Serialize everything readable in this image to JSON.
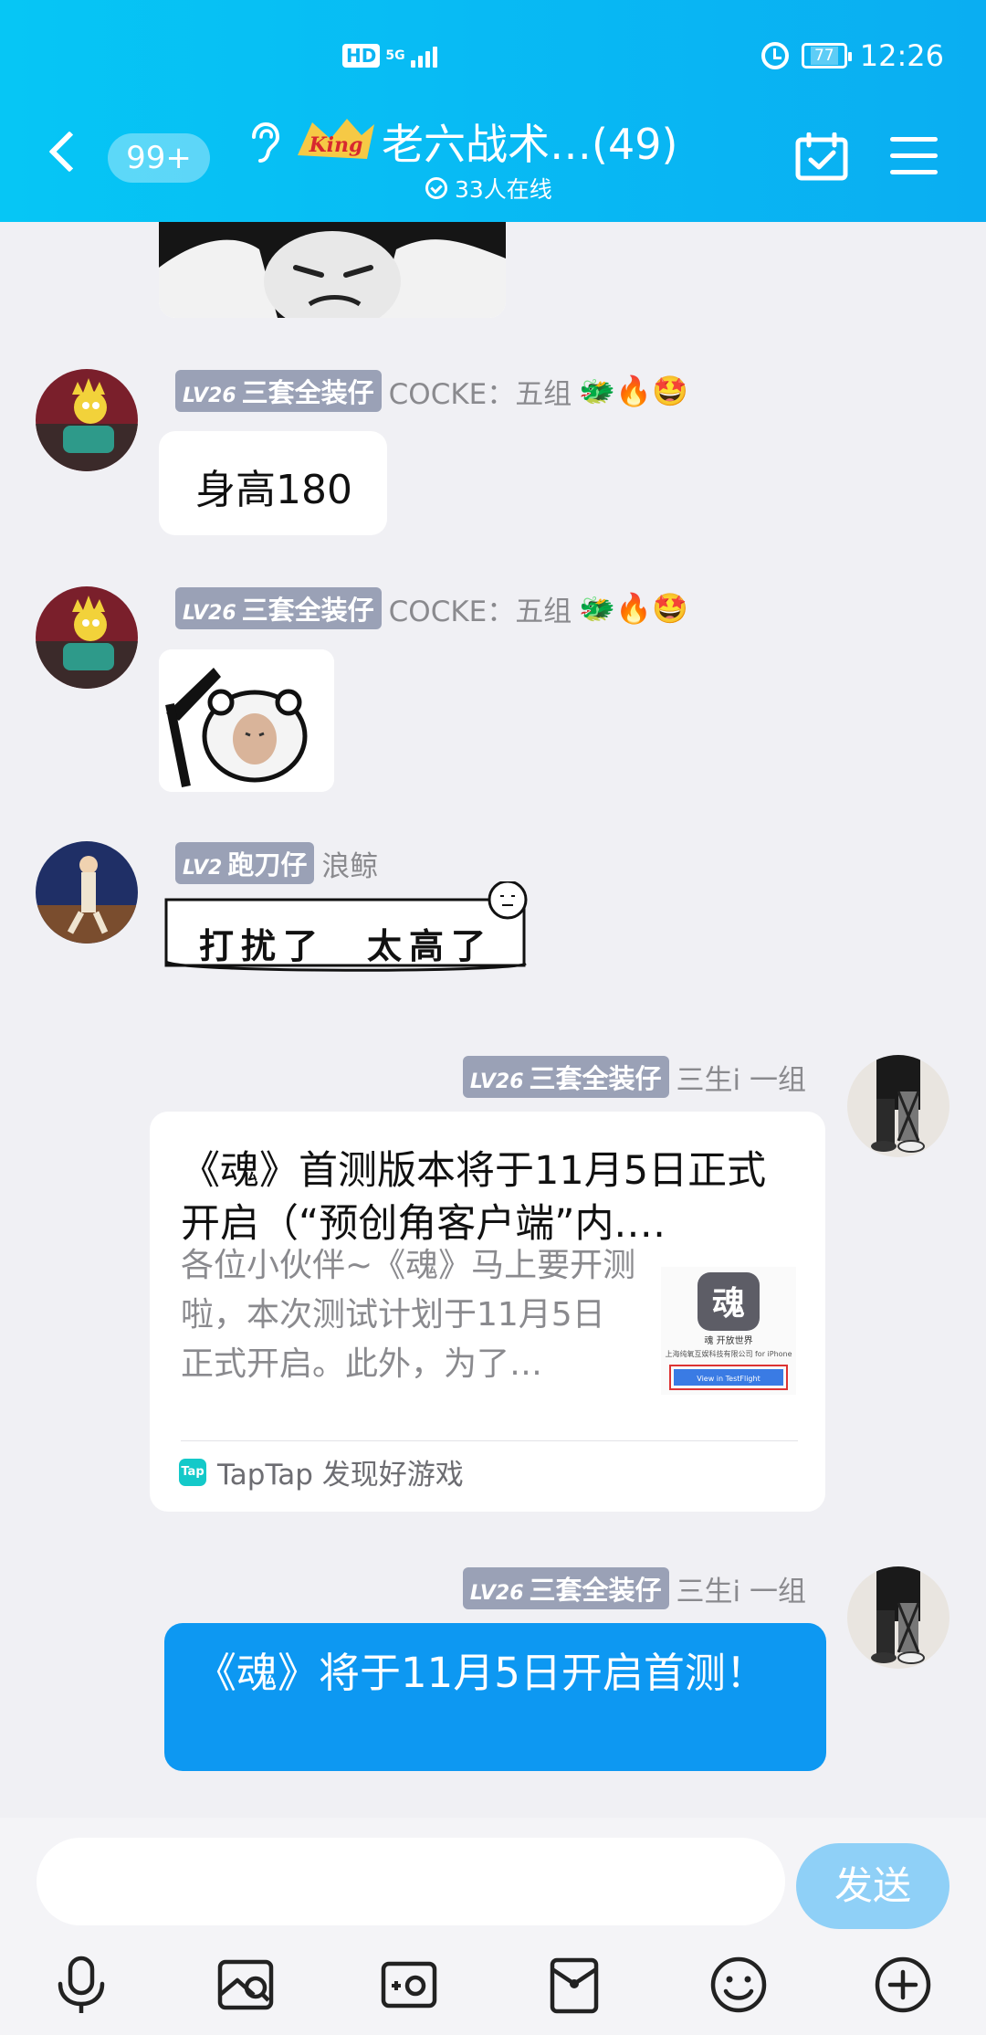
{
  "status_bar": {
    "hd": "HD",
    "network": "5G",
    "battery": "77",
    "time": "12:26"
  },
  "header": {
    "unread_badge": "99+",
    "group_name": "老六战术…(49)",
    "online_count": "33人在线",
    "logo_text": "King"
  },
  "messages": [
    {
      "type": "text",
      "side": "left",
      "level": "LV26",
      "title": "三套全装仔",
      "name": "COCKE：五组",
      "emojis": "🐲🔥🤩",
      "text": "身高180"
    },
    {
      "type": "sticker",
      "side": "left",
      "level": "LV26",
      "title": "三套全装仔",
      "name": "COCKE：五组",
      "emojis": "🐲🔥🤩"
    },
    {
      "type": "sticker",
      "side": "left",
      "level": "LV2",
      "title": "跑刀仔",
      "name": "浪鲸",
      "sticker_text": "打扰了　太高了"
    },
    {
      "type": "card",
      "side": "right",
      "level": "LV26",
      "title": "三套全装仔",
      "name": "三生i 一组",
      "card_title": "《魂》首测版本将于11月5日正式开启（“预创角客户端”内.…",
      "card_desc": "各位小伙伴~《魂》马上要开测啦，本次测试计划于11月5日正式开启。此外，为了…",
      "thumb_char": "魂",
      "thumb_caption": "魂 开放世界",
      "thumb_company": "上海纯氧互娱科技有限公司 for iPhone",
      "thumb_button": "View in TestFlight",
      "source_icon": "Tap",
      "source": "TapTap 发现好游戏"
    },
    {
      "type": "text",
      "side": "right",
      "level": "LV26",
      "title": "三套全装仔",
      "name": "三生i 一组",
      "text": "《魂》将于11月5日开启首测！"
    }
  ],
  "input": {
    "placeholder": "",
    "send_label": "发送"
  },
  "toolbar": [
    "microphone-icon",
    "image-icon",
    "camera-icon",
    "red-packet-icon",
    "emoji-icon",
    "plus-icon"
  ],
  "colors": {
    "header": "#0aaef2",
    "bubble_self": "#0d98f2",
    "send_button": "#8fd0f7",
    "level_badge": "#9aa1b6"
  }
}
